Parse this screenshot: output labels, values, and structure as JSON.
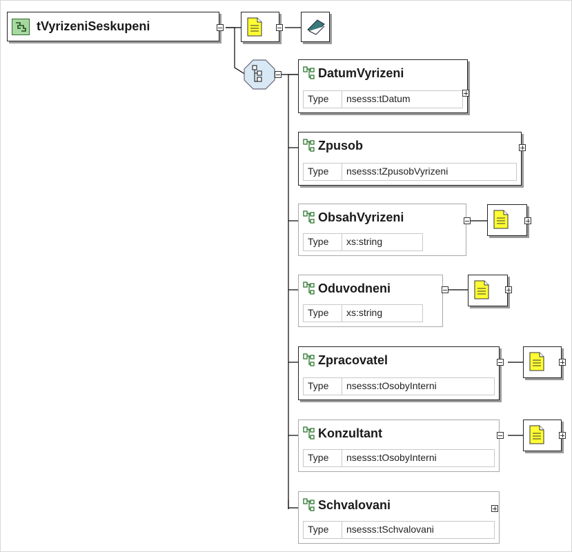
{
  "complex_type": {
    "name": "tVyrizeniSeskupeni",
    "icon": "complex-type-icon"
  },
  "sequence_icon": "sequence-compositor-icon",
  "annotation_icon": "documentation-icon",
  "appinfo_icon": "appinfo-book-icon",
  "type_label": "Type",
  "elements": [
    {
      "name": "DatumVyrizeni",
      "type": "nsesss:tDatum",
      "required": true,
      "has_doc": false,
      "expand": "plus"
    },
    {
      "name": "Zpusob",
      "type": "nsesss:tZpusobVyrizeni",
      "required": true,
      "has_doc": false,
      "expand": "plus"
    },
    {
      "name": "ObsahVyrizeni",
      "type": "xs:string",
      "required": false,
      "has_doc": true,
      "expand": "minus"
    },
    {
      "name": "Oduvodneni",
      "type": "xs:string",
      "required": false,
      "has_doc": true,
      "expand": "minus"
    },
    {
      "name": "Zpracovatel",
      "type": "nsesss:tOsobyInterni",
      "required": true,
      "has_doc": true,
      "expand": "minus"
    },
    {
      "name": "Konzultant",
      "type": "nsesss:tOsobyInterni",
      "required": false,
      "has_doc": true,
      "expand": "minus"
    },
    {
      "name": "Schvalovani",
      "type": "nsesss:tSchvalovani",
      "required": false,
      "has_doc": false,
      "expand": "plus"
    }
  ],
  "colors": {
    "doc_yellow": "#ffff33",
    "complex_green": "#a8d8a0",
    "line": "#000000"
  }
}
